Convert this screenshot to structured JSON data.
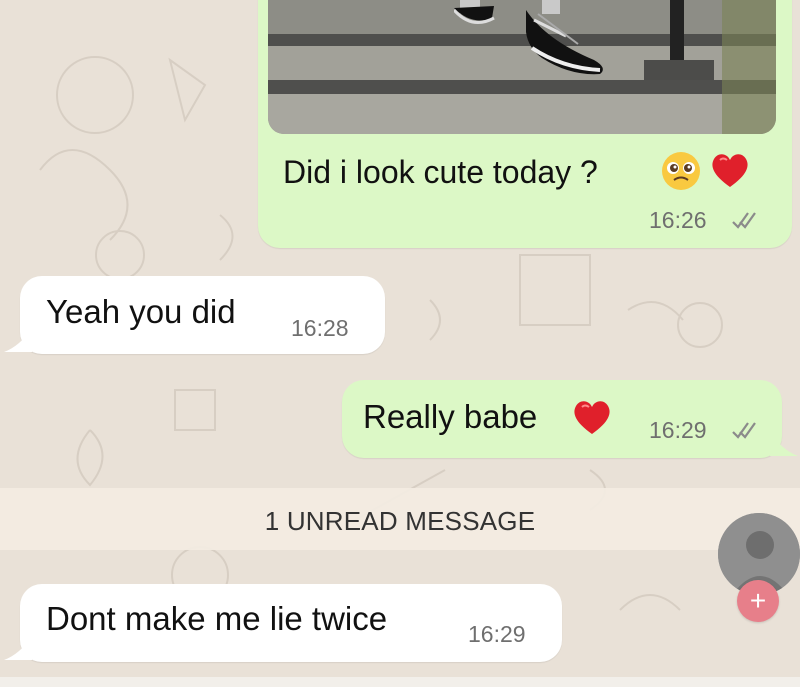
{
  "messages": [
    {
      "text": "Did i look cute today ?",
      "emoji": "🥺❤",
      "time": "16:26",
      "direction": "outgoing"
    },
    {
      "text": "Yeah you did",
      "time": "16:28",
      "direction": "incoming"
    },
    {
      "text": "Really babe",
      "emoji": "❤",
      "time": "16:29",
      "direction": "outgoing"
    },
    {
      "text": "Dont make me lie twice",
      "time": "16:29",
      "direction": "incoming"
    }
  ],
  "unread": {
    "label": "1 UNREAD MESSAGE"
  },
  "colors": {
    "outgoing_bubble": "#dcf8c6",
    "incoming_bubble": "#ffffff",
    "chat_background": "#e9e1d7",
    "unread_bar": "#f3ece2",
    "tick_gray": "#8b8b8b",
    "heart_red": "#e0202b",
    "add_badge_pink": "#e77f8a"
  },
  "icons": {
    "double_tick": "double-check-icon",
    "pleading_face": "pleading-face-icon",
    "heart": "red-heart-icon",
    "add": "plus-icon"
  }
}
